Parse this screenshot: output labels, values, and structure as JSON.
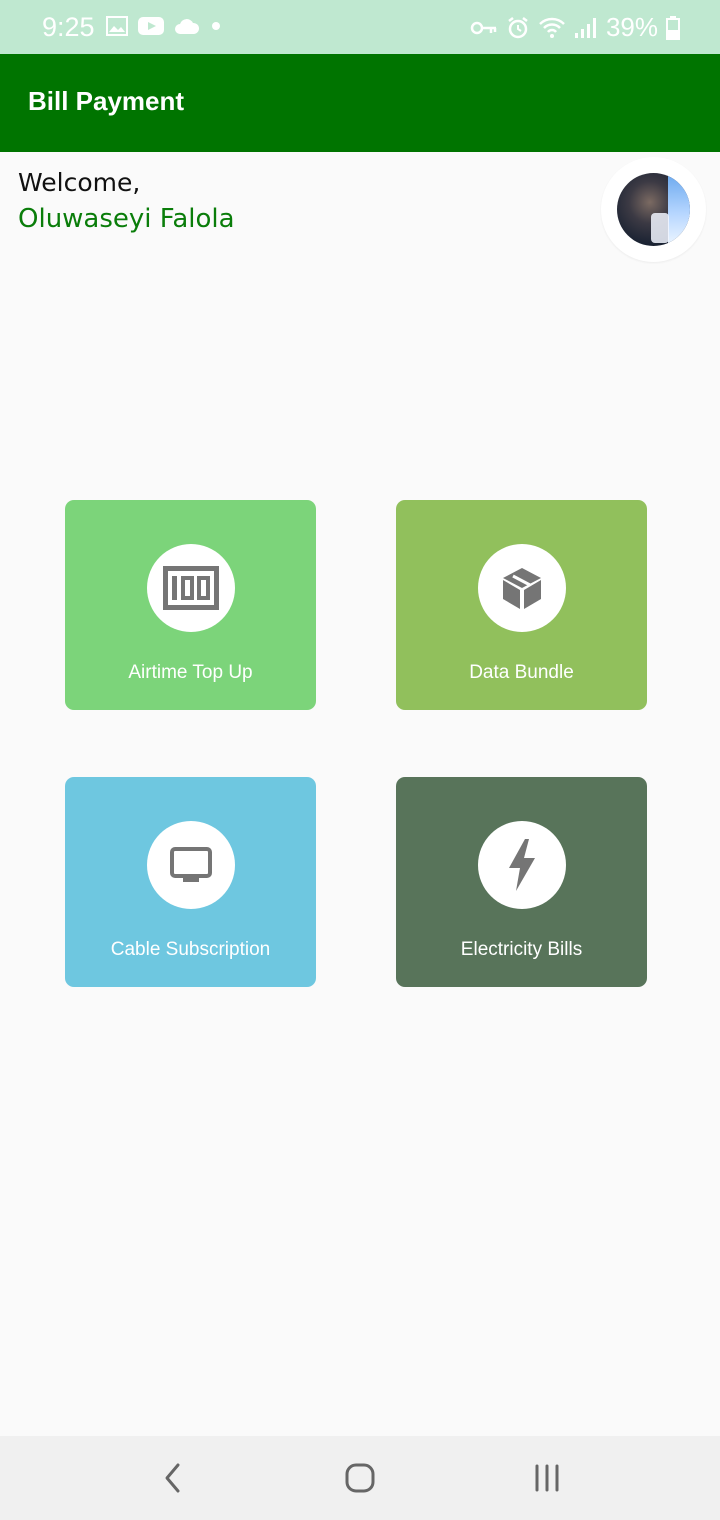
{
  "status_bar": {
    "time": "9:25",
    "battery_text": "39%",
    "left_icons": [
      "image-icon",
      "youtube-icon",
      "cloud-icon",
      "dot-icon"
    ],
    "right_icons": [
      "vpn-key-icon",
      "alarm-icon",
      "wifi-icon",
      "signal-icon",
      "battery-icon"
    ]
  },
  "app_bar": {
    "title": "Bill Payment",
    "background": "#007400"
  },
  "greeting": {
    "welcome": "Welcome,",
    "user_name": "Oluwaseyi Falola",
    "user_name_color": "#0a7d0a"
  },
  "profile": {
    "avatar_icon": "user-avatar"
  },
  "services": [
    {
      "label": "Airtime Top Up",
      "icon": "airtime-100-icon",
      "color": "#7cd47a"
    },
    {
      "label": "Data Bundle",
      "icon": "cube-icon",
      "color": "#91c05c"
    },
    {
      "label": "Cable Subscription",
      "icon": "tv-icon",
      "color": "#6ec7e0"
    },
    {
      "label": "Electricity Bills",
      "icon": "bolt-icon",
      "color": "#58745a"
    }
  ],
  "nav_bar": {
    "buttons": [
      "back-icon",
      "home-icon",
      "recents-icon"
    ]
  }
}
